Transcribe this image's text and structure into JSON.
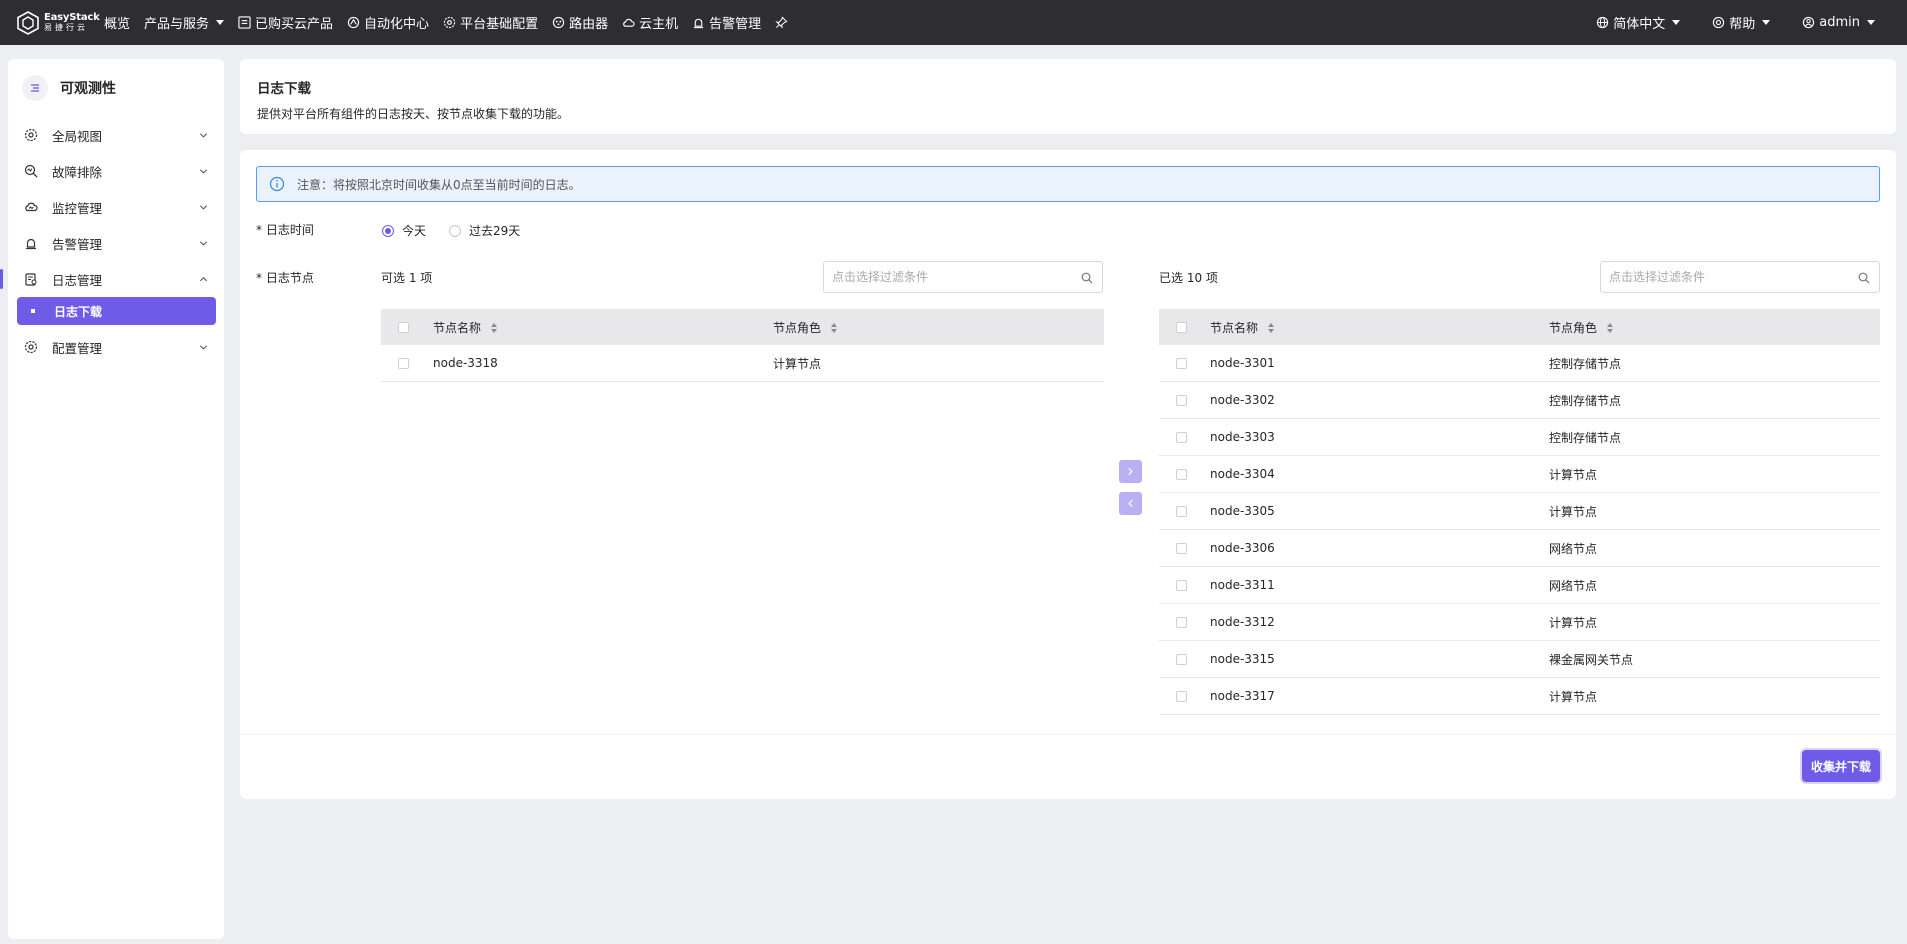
{
  "topbar": {
    "logo_en": "EasyStack",
    "logo_cn": "易捷行云",
    "nav": [
      {
        "label": "概览",
        "icon": "",
        "dropdown": false
      },
      {
        "label": "产品与服务",
        "icon": "",
        "dropdown": true
      },
      {
        "label": "已购买云产品",
        "icon": "list-icon",
        "dropdown": false
      },
      {
        "label": "自动化中心",
        "icon": "automation-icon",
        "dropdown": false
      },
      {
        "label": "平台基础配置",
        "icon": "gear-icon",
        "dropdown": false
      },
      {
        "label": "路由器",
        "icon": "router-icon",
        "dropdown": false
      },
      {
        "label": "云主机",
        "icon": "cloud-icon",
        "dropdown": false
      },
      {
        "label": "告警管理",
        "icon": "alarm-icon",
        "dropdown": false
      }
    ],
    "language": "简体中文",
    "help": "帮助",
    "user": "admin"
  },
  "sidebar": {
    "title": "可观测性",
    "items": [
      {
        "label": "全局视图",
        "icon": "dashboard-icon"
      },
      {
        "label": "故障排除",
        "icon": "troubleshoot-icon"
      },
      {
        "label": "监控管理",
        "icon": "monitor-icon"
      },
      {
        "label": "告警管理",
        "icon": "alarm-icon"
      },
      {
        "label": "日志管理",
        "icon": "log-icon"
      },
      {
        "label": "配置管理",
        "icon": "config-icon"
      }
    ],
    "active_sub": "日志下载"
  },
  "header": {
    "title": "日志下载",
    "description": "提供对平台所有组件的日志按天、按节点收集下载的功能。"
  },
  "notice": "注意：将按照北京时间收集从0点至当前时间的日志。",
  "form": {
    "time_label": "* 日志时间",
    "time_options": [
      "今天",
      "过去29天"
    ],
    "time_selected": "今天",
    "node_label": "* 日志节点"
  },
  "left_panel": {
    "count_text": "可选 1 项",
    "search_placeholder": "点击选择过滤条件",
    "columns": [
      "节点名称",
      "节点角色"
    ],
    "rows": [
      {
        "name": "node-3318",
        "role": "计算节点"
      }
    ]
  },
  "right_panel": {
    "count_text": "已选 10 项",
    "search_placeholder": "点击选择过滤条件",
    "columns": [
      "节点名称",
      "节点角色"
    ],
    "rows": [
      {
        "name": "node-3301",
        "role": "控制存储节点"
      },
      {
        "name": "node-3302",
        "role": "控制存储节点"
      },
      {
        "name": "node-3303",
        "role": "控制存储节点"
      },
      {
        "name": "node-3304",
        "role": "计算节点"
      },
      {
        "name": "node-3305",
        "role": "计算节点"
      },
      {
        "name": "node-3306",
        "role": "网络节点"
      },
      {
        "name": "node-3311",
        "role": "网络节点"
      },
      {
        "name": "node-3312",
        "role": "计算节点"
      },
      {
        "name": "node-3315",
        "role": "裸金属网关节点"
      },
      {
        "name": "node-3317",
        "role": "计算节点"
      }
    ]
  },
  "submit_label": "收集并下载",
  "colors": {
    "accent": "#6e5ce9",
    "topbar": "#2e2e30",
    "notice_border": "#5b9cf0"
  }
}
